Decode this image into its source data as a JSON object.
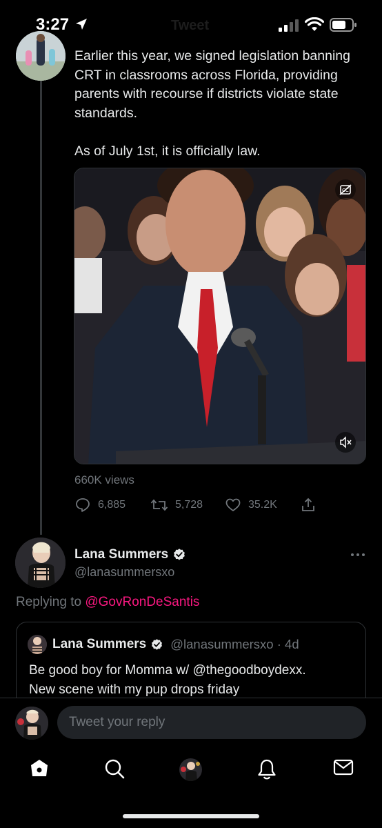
{
  "status_bar": {
    "time": "3:27",
    "background_title": "Tweet"
  },
  "tweet": {
    "paragraphs": [
      "Earlier this year, we signed legislation banning CRT in classrooms across Florida, providing parents with recourse if districts violate state standards.",
      "As of July 1st, it is officially law."
    ],
    "views": "660K views",
    "replies": "6,885",
    "retweets": "5,728",
    "likes": "35.2K"
  },
  "reply": {
    "name": "Lana Summers",
    "handle": "@lanasummersxo",
    "replying_prefix": "Replying to",
    "replying_to": "@GovRonDeSantis",
    "quote": {
      "name": "Lana Summers",
      "handle_time": "@lanasummersxo · 4d",
      "text_line1": "Be good boy for Momma w/ @thegoodboydexx.",
      "text_line2": "New scene with my pup drops friday"
    }
  },
  "composer": {
    "placeholder": "Tweet your reply"
  },
  "icons": {
    "verified": "verified-badge-icon",
    "reply": "reply-icon",
    "retweet": "retweet-icon",
    "like": "heart-icon",
    "share": "share-icon",
    "more": "more-icon",
    "captions": "captions-icon",
    "mute": "mute-icon",
    "home": "home-icon",
    "search": "search-icon",
    "spaces": "spaces-avatar-icon",
    "notifications": "bell-icon",
    "messages": "mail-icon"
  },
  "colors": {
    "background": "#000000",
    "text": "#e7e9ea",
    "secondary": "#71767b",
    "mention": "#f91880",
    "verified": "#e7e9ea",
    "border": "#2f3336"
  }
}
